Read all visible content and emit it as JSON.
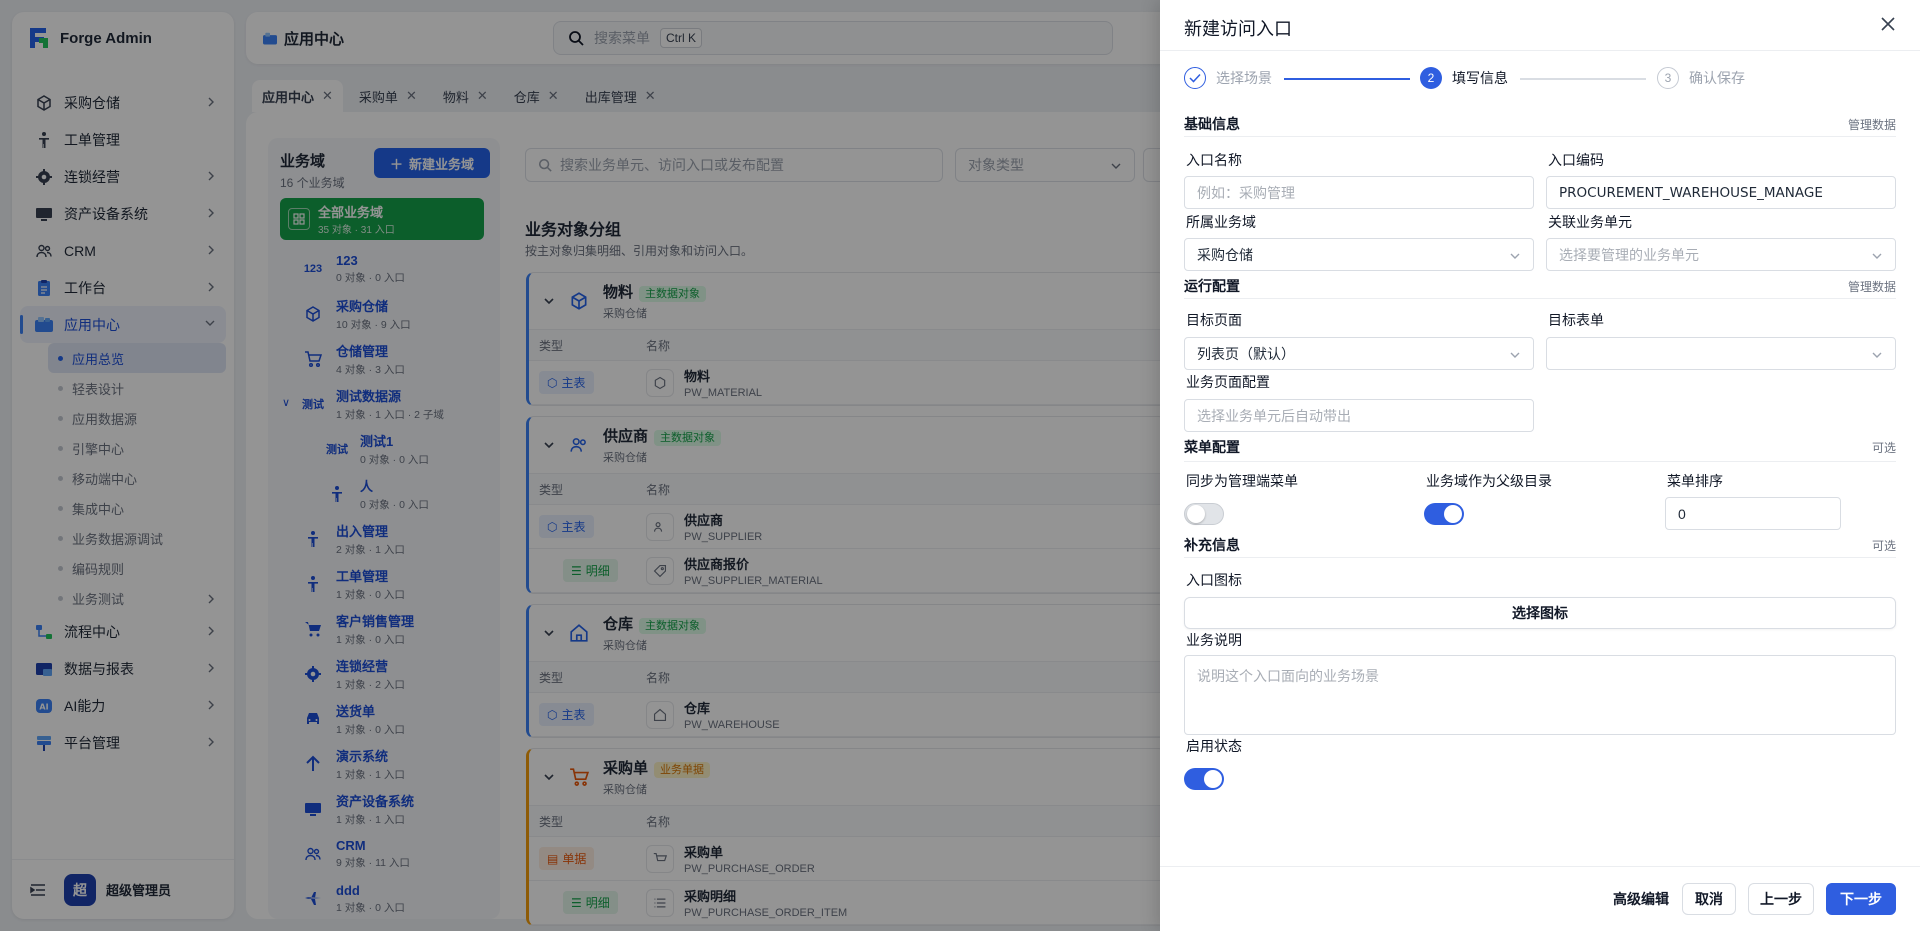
{
  "app": {
    "brand": "Forge Admin"
  },
  "sidebar": {
    "items": [
      {
        "label": "采购仓储"
      },
      {
        "label": "工单管理"
      },
      {
        "label": "连锁经营"
      },
      {
        "label": "资产设备系统"
      },
      {
        "label": "CRM"
      },
      {
        "label": "工作台"
      },
      {
        "label": "应用中心"
      },
      {
        "label": "流程中心"
      },
      {
        "label": "数据与报表"
      },
      {
        "label": "AI能力"
      },
      {
        "label": "平台管理"
      }
    ],
    "sub_items": [
      {
        "label": "应用总览"
      },
      {
        "label": "轻表设计"
      },
      {
        "label": "应用数据源"
      },
      {
        "label": "引擎中心"
      },
      {
        "label": "移动端中心"
      },
      {
        "label": "集成中心"
      },
      {
        "label": "业务数据源调试"
      },
      {
        "label": "编码规则"
      },
      {
        "label": "业务测试"
      }
    ],
    "user": {
      "avatar": "超",
      "name": "超级管理员"
    }
  },
  "header": {
    "title": "应用中心",
    "search_placeholder": "搜索菜单",
    "shortcut": "Ctrl K"
  },
  "tabs": [
    {
      "label": "应用中心"
    },
    {
      "label": "采购单"
    },
    {
      "label": "物料"
    },
    {
      "label": "仓库"
    },
    {
      "label": "出库管理"
    }
  ],
  "domains": {
    "title": "业务域",
    "count": "16 个业务域",
    "new_button": "新建业务域",
    "all": {
      "name": "全部业务域",
      "meta": "35 对象 · 31 入口"
    },
    "items": [
      {
        "icon": "123",
        "name": "123",
        "meta": "0 对象 · 0 入口"
      },
      {
        "icon": "cube",
        "name": "采购仓储",
        "meta": "10 对象 · 9 入口"
      },
      {
        "icon": "cart",
        "name": "仓储管理",
        "meta": "4 对象 · 3 入口"
      },
      {
        "icon": "测试",
        "name": "测试数据源",
        "meta": "1 对象 · 1 入口 · 2 子域"
      },
      {
        "icon": "测试",
        "name": "测试1",
        "meta": "0 对象 · 0 入口"
      },
      {
        "icon": "person",
        "name": "人",
        "meta": "0 对象 · 0 入口"
      },
      {
        "icon": "person",
        "name": "出入管理",
        "meta": "2 对象 · 1 入口"
      },
      {
        "icon": "person",
        "name": "工单管理",
        "meta": "1 对象 · 0 入口"
      },
      {
        "icon": "cart",
        "name": "客户销售管理",
        "meta": "1 对象 · 0 入口"
      },
      {
        "icon": "gear",
        "name": "连锁经营",
        "meta": "1 对象 · 2 入口"
      },
      {
        "icon": "car",
        "name": "送货单",
        "meta": "1 对象 · 0 入口"
      },
      {
        "icon": "arrow",
        "name": "演示系统",
        "meta": "1 对象 · 1 入口"
      },
      {
        "icon": "monitor",
        "name": "资产设备系统",
        "meta": "1 对象 · 1 入口"
      },
      {
        "icon": "users",
        "name": "CRM",
        "meta": "9 对象 · 11 入口"
      },
      {
        "icon": "plane",
        "name": "ddd",
        "meta": "1 对象 · 0 入口"
      }
    ]
  },
  "groups": {
    "search_placeholder": "搜索业务单元、访问入口或发布配置",
    "type_placeholder": "对象类型",
    "title": "业务对象分组",
    "subtitle": "按主对象归集明细、引用对象和访问入口。",
    "col_type": "类型",
    "col_name": "名称",
    "cards": [
      {
        "name": "物料",
        "tag": "主数据对象",
        "sub": "采购仓储",
        "rows": [
          {
            "tag": "主表",
            "name": "物料",
            "code": "PW_MATERIAL"
          }
        ]
      },
      {
        "name": "供应商",
        "tag": "主数据对象",
        "sub": "采购仓储",
        "rows": [
          {
            "tag": "主表",
            "name": "供应商",
            "code": "PW_SUPPLIER"
          },
          {
            "tag": "明细",
            "name": "供应商报价",
            "code": "PW_SUPPLIER_MATERIAL"
          }
        ]
      },
      {
        "name": "仓库",
        "tag": "主数据对象",
        "sub": "采购仓储",
        "rows": [
          {
            "tag": "主表",
            "name": "仓库",
            "code": "PW_WAREHOUSE"
          }
        ]
      },
      {
        "name": "采购单",
        "tag": "业务单据",
        "sub": "采购仓储",
        "rows": [
          {
            "tag": "单据",
            "name": "采购单",
            "code": "PW_PURCHASE_ORDER"
          },
          {
            "tag": "明细",
            "name": "采购明细",
            "code": "PW_PURCHASE_ORDER_ITEM"
          }
        ]
      }
    ]
  },
  "drawer": {
    "title": "新建访问入口",
    "steps": [
      {
        "num": "1",
        "label": "选择场景"
      },
      {
        "num": "2",
        "label": "填写信息"
      },
      {
        "num": "3",
        "label": "确认保存"
      }
    ],
    "sections": {
      "basic": {
        "title": "基础信息",
        "link": "管理数据"
      },
      "runtime": {
        "title": "运行配置",
        "link": "管理数据"
      },
      "menu": {
        "title": "菜单配置",
        "link": "可选"
      },
      "extra": {
        "title": "补充信息",
        "link": "可选"
      }
    },
    "fields": {
      "entry_name": {
        "label": "入口名称",
        "placeholder": "例如：采购管理"
      },
      "entry_code": {
        "label": "入口编码",
        "value": "PROCUREMENT_WAREHOUSE_MANAGE"
      },
      "domain": {
        "label": "所属业务域",
        "value": "采购仓储"
      },
      "unit": {
        "label": "关联业务单元",
        "placeholder": "选择要管理的业务单元"
      },
      "target_page": {
        "label": "目标页面",
        "value": "列表页（默认）"
      },
      "target_form": {
        "label": "目标表单",
        "value": ""
      },
      "page_config": {
        "label": "业务页面配置",
        "placeholder": "选择业务单元后自动带出"
      },
      "sync_menu": {
        "label": "同步为管理端菜单",
        "on": false
      },
      "domain_parent": {
        "label": "业务域作为父级目录",
        "on": true
      },
      "menu_order": {
        "label": "菜单排序",
        "value": "0"
      },
      "entry_icon": {
        "label": "入口图标",
        "button": "选择图标"
      },
      "description": {
        "label": "业务说明",
        "placeholder": "说明这个入口面向的业务场景"
      },
      "enabled": {
        "label": "启用状态",
        "on": true
      }
    },
    "footer": {
      "advanced": "高级编辑",
      "cancel": "取消",
      "prev": "上一步",
      "next": "下一步"
    }
  }
}
